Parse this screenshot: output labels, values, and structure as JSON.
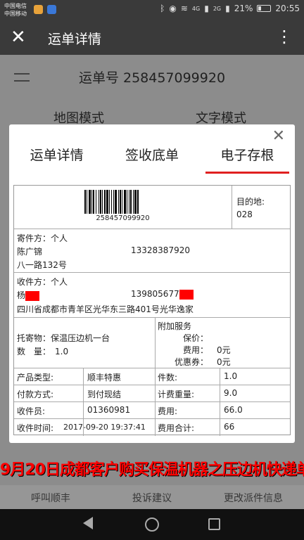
{
  "status_bar": {
    "carrier1": "中国电信",
    "carrier2": "中国移动",
    "network1": "4G",
    "network2": "2G",
    "battery": "21%",
    "time": "20:55",
    "icons": [
      "bluetooth-icon",
      "eye-icon",
      "wifi-icon",
      "signal-icon",
      "battery-icon"
    ]
  },
  "app_bar": {
    "title": "运单详情",
    "close_icon": "close-icon",
    "more_icon": "more-vertical-icon"
  },
  "background_page": {
    "order_number": "运单号 258457099920",
    "mode_map": "地图模式",
    "mode_text": "文字模式",
    "actions": [
      "呼叫顺丰",
      "投诉建议",
      "更改派件信息"
    ]
  },
  "modal": {
    "tabs": [
      {
        "label": "运单详情",
        "active": false
      },
      {
        "label": "签收底单",
        "active": false
      },
      {
        "label": "电子存根",
        "active": true
      }
    ],
    "accent_color": "#e02020",
    "barcode_number": "258457099920",
    "destination_label": "目的地:",
    "destination_code": "028",
    "sender": {
      "label": "寄件方：个人",
      "name": "陈广锦",
      "phone": "13328387920",
      "address": "八一路132号"
    },
    "receiver": {
      "label": "收件方：个人",
      "name": "杨",
      "phone": "139805677",
      "address": "四川省成都市青羊区光华东三路401号光华逸家"
    },
    "cargo": {
      "item_label": "托寄物：",
      "item": "保温压边机一台",
      "qty_label": "数　量：",
      "qty": "1.0"
    },
    "extra": {
      "title": "附加服务",
      "insure_label": "保价：",
      "fee_label": "费用：",
      "fee": "0元",
      "coupon_label": "优惠券：",
      "coupon": "0元"
    },
    "table": [
      [
        "产品类型:",
        "顺丰特惠",
        "件数:",
        "1.0"
      ],
      [
        "付款方式:",
        "到付现结",
        "计费重量:",
        "9.0"
      ],
      [
        "收件员:",
        "01360981",
        "费用:",
        "66.0"
      ],
      [
        "收件时间:",
        "2017-09-20 19:37:41",
        "费用合计:",
        "66"
      ]
    ]
  },
  "caption": "9月20日成都客户购买保温机器之压边机快递单"
}
